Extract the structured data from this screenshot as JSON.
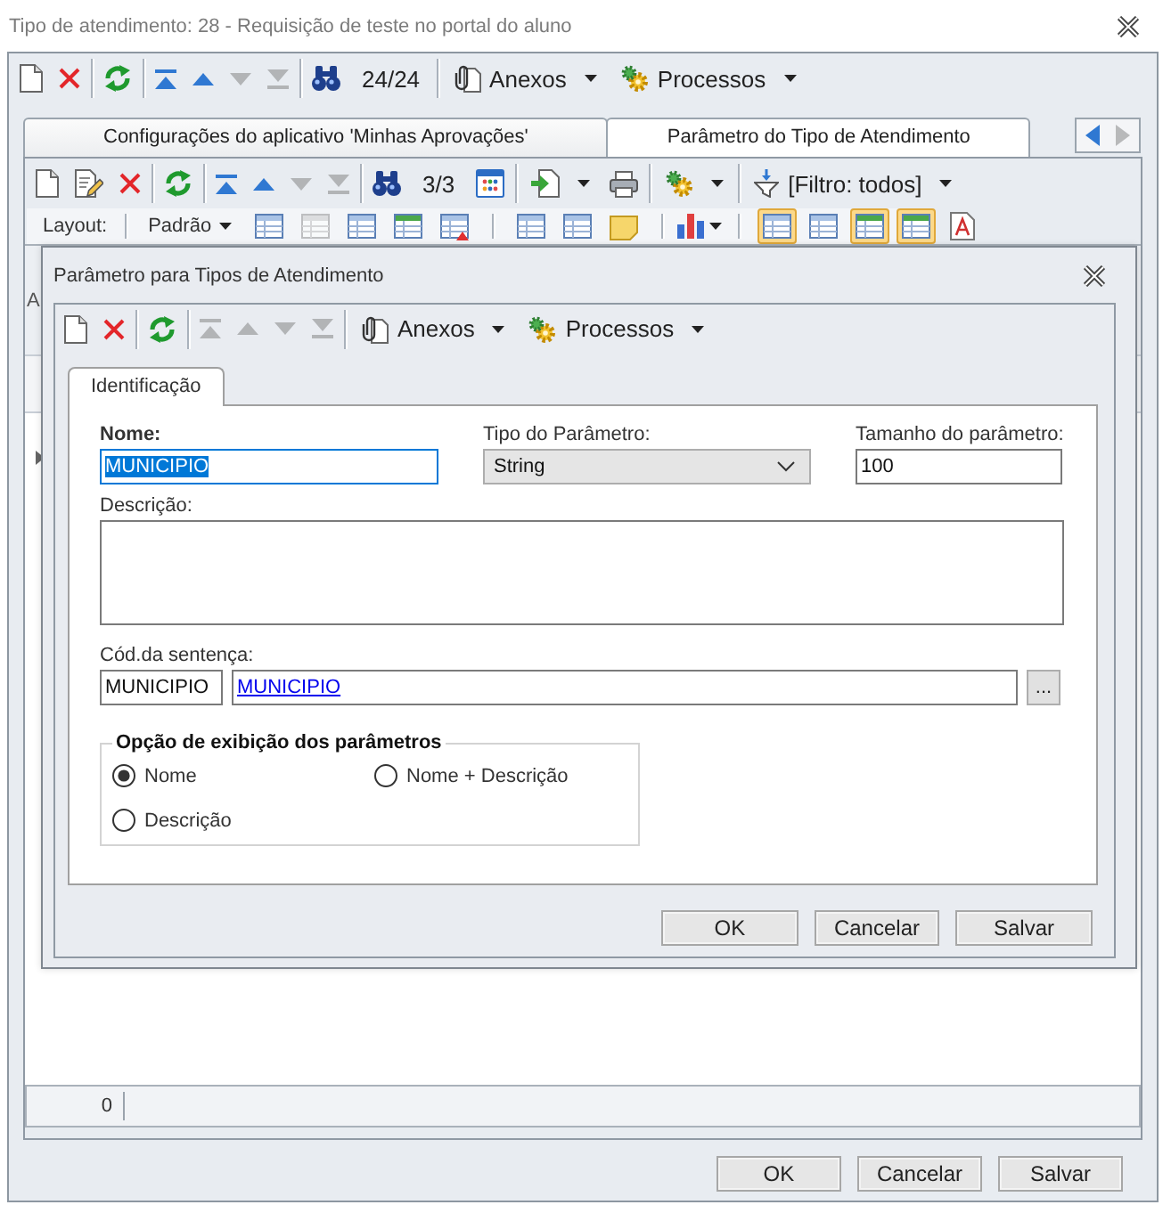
{
  "window": {
    "title": "Tipo de atendimento: 28 - Requisição de teste no portal do aluno"
  },
  "toolbar": [
    [
      {
        "kind": "new",
        "disabled": false
      },
      {
        "kind": "delete",
        "disabled": false
      }
    ],
    [
      {
        "kind": "refresh",
        "disabled": false
      }
    ],
    [
      {
        "kind": "first",
        "disabled": false
      },
      {
        "kind": "previous",
        "disabled": false
      },
      {
        "kind": "next",
        "disabled": true
      },
      {
        "kind": "last",
        "disabled": true
      }
    ],
    [
      {
        "kind": "find",
        "disabled": false
      },
      {
        "kind": "counter",
        "label": "24/24"
      }
    ],
    [
      {
        "kind": "attachments",
        "label": "Anexos"
      },
      {
        "kind": "processes",
        "label": "Processos"
      }
    ]
  ],
  "tabs": [
    {
      "label": "Configurações do aplicativo 'Minhas Aprovações'",
      "selected": false
    },
    {
      "label": "Parâmetro do Tipo de Atendimento",
      "selected": true
    }
  ],
  "tab_scroll": [
    {
      "disabled": false
    },
    {
      "disabled": true
    }
  ],
  "panel": {
    "toolbar": [
      [
        {
          "kind": "new",
          "disabled": false
        },
        {
          "kind": "edit",
          "disabled": false
        },
        {
          "kind": "delete",
          "disabled": false
        }
      ],
      [
        {
          "kind": "refresh",
          "disabled": false
        }
      ],
      [
        {
          "kind": "first",
          "disabled": false
        },
        {
          "kind": "previous",
          "disabled": false
        },
        {
          "kind": "next",
          "disabled": true
        },
        {
          "kind": "last",
          "disabled": true
        }
      ],
      [
        {
          "kind": "find",
          "disabled": false
        },
        {
          "kind": "counter",
          "label": "3/3"
        },
        {
          "kind": "columns",
          "disabled": false
        }
      ],
      [
        {
          "kind": "export"
        },
        {
          "kind": "print",
          "disabled": false
        }
      ],
      [
        {
          "kind": "processes"
        }
      ],
      [
        {
          "kind": "filter",
          "label": "[Filtro: todos]"
        }
      ]
    ],
    "layout_bar": {
      "label": "Layout:",
      "preset": "Padrão",
      "tools": [
        [
          {
            "kind": "sheet",
            "on": false,
            "disabled": false
          },
          {
            "kind": "sheet",
            "on": false,
            "disabled": true
          },
          {
            "kind": "sheet",
            "on": false,
            "disabled": false
          },
          {
            "kind": "sheet_green",
            "on": false,
            "disabled": false
          },
          {
            "kind": "sheet_red",
            "on": false,
            "disabled": false
          }
        ],
        [
          {
            "kind": "sheet",
            "on": false,
            "disabled": false
          },
          {
            "kind": "sheet",
            "on": false,
            "disabled": false
          },
          {
            "kind": "note",
            "on": false,
            "disabled": false
          }
        ],
        [
          {
            "kind": "chart",
            "on": false,
            "disabled": false
          }
        ],
        [
          {
            "kind": "sheet",
            "on": true,
            "disabled": false
          },
          {
            "kind": "sheet",
            "on": false,
            "disabled": false
          },
          {
            "kind": "sheet_green",
            "on": true,
            "disabled": false
          },
          {
            "kind": "sheet_green",
            "on": true,
            "disabled": false
          },
          {
            "kind": "pdf",
            "on": false,
            "disabled": false
          }
        ]
      ]
    },
    "grid": {
      "group_panel_text": "A"
    },
    "status_bar": {
      "count": "0"
    }
  },
  "dialog": {
    "title": "Parâmetro para Tipos de Atendimento",
    "toolbar": [
      [
        {
          "kind": "new",
          "disabled": false
        },
        {
          "kind": "delete",
          "disabled": false
        }
      ],
      [
        {
          "kind": "refresh",
          "disabled": false
        }
      ],
      [
        {
          "kind": "first",
          "disabled": true
        },
        {
          "kind": "previous",
          "disabled": true
        },
        {
          "kind": "next",
          "disabled": true
        },
        {
          "kind": "last",
          "disabled": true
        }
      ],
      [
        {
          "kind": "attachments",
          "label": "Anexos"
        },
        {
          "kind": "processes",
          "label": "Processos"
        }
      ]
    ],
    "tabs": [
      {
        "label": "Identificação",
        "selected": true
      }
    ],
    "form": {
      "name": {
        "label": "Nome:",
        "value": "MUNICIPIO",
        "required": true,
        "focused": true,
        "text_selected": true
      },
      "parameter_type": {
        "label": "Tipo do Parâmetro:",
        "value": "String"
      },
      "parameter_size": {
        "label": "Tamanho do parâmetro:",
        "value": "100"
      },
      "description": {
        "label": "Descrição:"
      },
      "sentence_code": {
        "label": "Cód.da sentença:",
        "code": "MUNICIPIO",
        "link": "MUNICIPIO",
        "button": "..."
      }
    },
    "options": {
      "title": "Opção de exibição dos parâmetros",
      "items": [
        {
          "label": "Nome",
          "selected": true
        },
        {
          "label": "Nome + Descrição",
          "selected": false
        },
        {
          "label": "Descrição",
          "selected": false
        }
      ]
    },
    "buttons": [
      "OK",
      "Cancelar",
      "Salvar"
    ]
  },
  "buttons": [
    "OK",
    "Cancelar",
    "Salvar"
  ]
}
